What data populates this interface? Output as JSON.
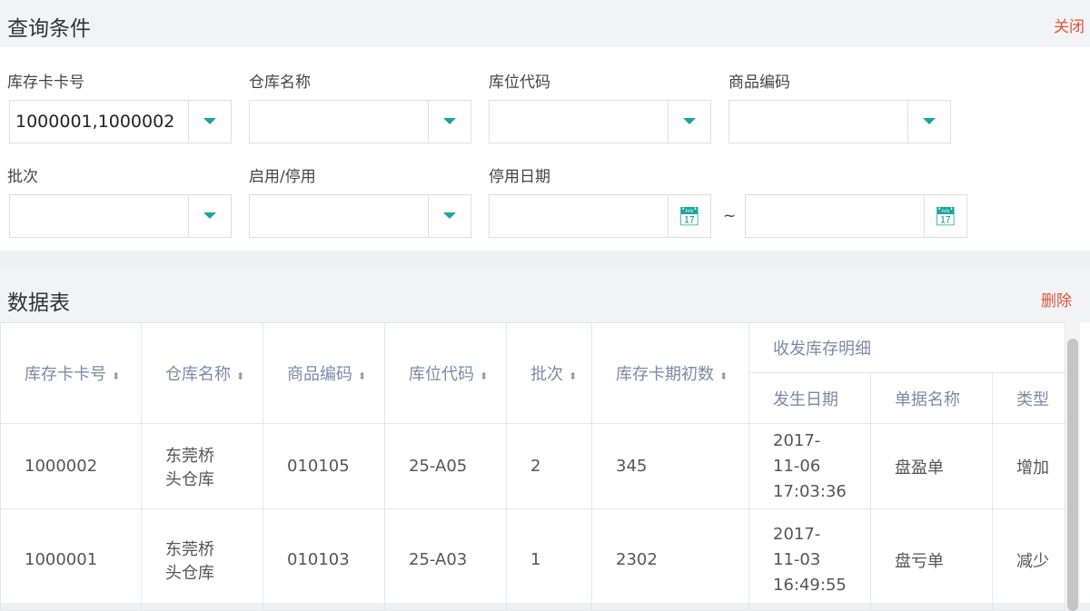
{
  "query": {
    "title": "查询条件",
    "close": "关闭",
    "fields": [
      {
        "label": "库存卡卡号",
        "value": "1000001,1000002"
      },
      {
        "label": "仓库名称",
        "value": ""
      },
      {
        "label": "库位代码",
        "value": ""
      },
      {
        "label": "商品编码",
        "value": ""
      },
      {
        "label": "批次",
        "value": ""
      },
      {
        "label": "启用/停用",
        "value": ""
      },
      {
        "label": "停用日期",
        "value": ""
      }
    ],
    "tilde": "~"
  },
  "table": {
    "title": "数据表",
    "delete": "删除",
    "headers": [
      "库存卡卡号",
      "仓库名称",
      "商品编码",
      "库位代码",
      "批次",
      "库存卡期初数"
    ],
    "group": "收发库存明细",
    "subheaders": [
      "发生日期",
      "单据名称",
      "类型"
    ],
    "rows": [
      [
        "1000002",
        "东莞桥头仓库",
        "010105",
        "25-A05",
        "2",
        "345",
        "2017-11-06 17:03:36",
        "盘盈单",
        "增加"
      ],
      [
        "1000001",
        "东莞桥头仓库",
        "010103",
        "25-A03",
        "1",
        "2302",
        "2017-11-03 16:49:55",
        "盘亏单",
        "减少"
      ]
    ]
  }
}
